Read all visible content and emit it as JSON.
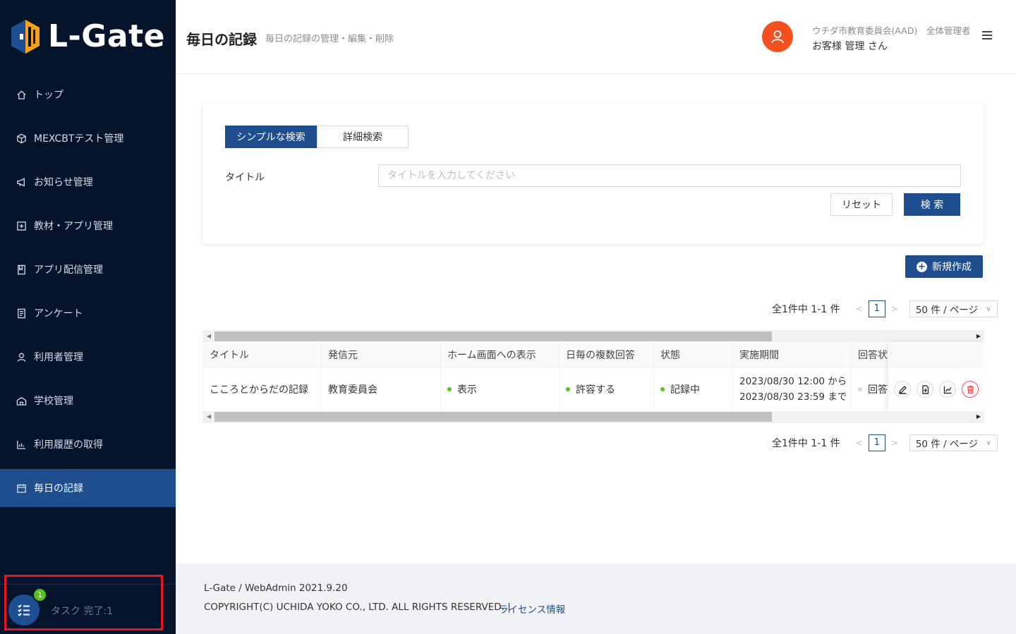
{
  "app": {
    "logo_text": "L-Gate"
  },
  "sidebar": {
    "items": [
      {
        "label": "トップ",
        "icon": "home-icon"
      },
      {
        "label": "MEXCBTテスト管理",
        "icon": "cube-icon"
      },
      {
        "label": "お知らせ管理",
        "icon": "megaphone-icon"
      },
      {
        "label": "教材・アプリ管理",
        "icon": "plus-square-icon"
      },
      {
        "label": "アプリ配信管理",
        "icon": "book-icon"
      },
      {
        "label": "アンケート",
        "icon": "survey-icon"
      },
      {
        "label": "利用者管理",
        "icon": "user-icon"
      },
      {
        "label": "学校管理",
        "icon": "school-icon"
      },
      {
        "label": "利用履歴の取得",
        "icon": "chart-icon"
      },
      {
        "label": "毎日の記録",
        "icon": "calendar-icon",
        "active": true
      }
    ],
    "task": {
      "badge": "1",
      "label": "タスク 完了:1"
    }
  },
  "header": {
    "title": "毎日の記録",
    "subtitle": "毎日の記録の管理・編集・削除",
    "org": "ウチダ市教育委員会(AAD)　全体管理者",
    "user": "お客様 管理 さん"
  },
  "search": {
    "tabs": [
      "シンプルな検索",
      "詳細検索"
    ],
    "field_label": "タイトル",
    "placeholder": "タイトルを入力してください",
    "reset_label": "リセット",
    "search_label": "検 索"
  },
  "new_button": "新規作成",
  "pagination": {
    "total": "全1件中 1-1 件",
    "prev": "<",
    "next": ">",
    "page": "1",
    "size": "50 件 / ページ",
    "size_chevron": "∨"
  },
  "table": {
    "headers": [
      "タイトル",
      "発信元",
      "ホーム画面への表示",
      "日毎の複数回答",
      "状態",
      "実施期間",
      "回答状"
    ],
    "rows": [
      {
        "title": "こころとからだの記録",
        "source": "教育委員会",
        "home_display": "表示",
        "multi_answer": "許容する",
        "status": "記録中",
        "period_start": "2023/08/30 12:00 から",
        "period_end": "2023/08/30 23:59 まで",
        "answer_status": "回答"
      }
    ]
  },
  "footer": {
    "version": "L-Gate / WebAdmin 2021.9.20",
    "copyright": "COPYRIGHT(C) UCHIDA YOKO CO., LTD. ALL RIGHTS RESERVED. |",
    "license": "ライセンス情報"
  },
  "colors": {
    "sidebar_bg": "#06142b",
    "primary": "#1f4e8e",
    "avatar": "#f5501e",
    "success": "#52c41a",
    "danger": "#ff4d4f",
    "highlight": "#e8141f"
  }
}
